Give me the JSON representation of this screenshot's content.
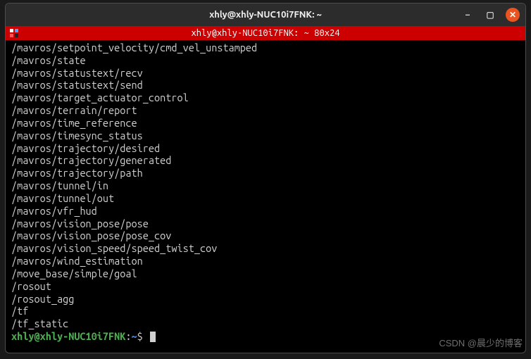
{
  "window": {
    "title": "xhly@xhly-NUC10i7FNK: ~",
    "tab_title": "xhly@xhly-NUC10i7FNK: ~ 80x24"
  },
  "terminal": {
    "lines": [
      "/mavros/setpoint_velocity/cmd_vel_unstamped",
      "/mavros/state",
      "/mavros/statustext/recv",
      "/mavros/statustext/send",
      "/mavros/target_actuator_control",
      "/mavros/terrain/report",
      "/mavros/time_reference",
      "/mavros/timesync_status",
      "/mavros/trajectory/desired",
      "/mavros/trajectory/generated",
      "/mavros/trajectory/path",
      "/mavros/tunnel/in",
      "/mavros/tunnel/out",
      "/mavros/vfr_hud",
      "/mavros/vision_pose/pose",
      "/mavros/vision_pose/pose_cov",
      "/mavros/vision_speed/speed_twist_cov",
      "/mavros/wind_estimation",
      "/move_base/simple/goal",
      "/rosout",
      "/rosout_agg",
      "/tf",
      "/tf_static"
    ],
    "prompt": {
      "user_host": "xhly@xhly-NUC10i7FNK",
      "sep": ":",
      "path": "~",
      "symbol": "$"
    }
  },
  "controls": {
    "minimize": "–",
    "maximize": "▢",
    "close": "✕"
  },
  "watermark": "CSDN @晨少的博客"
}
